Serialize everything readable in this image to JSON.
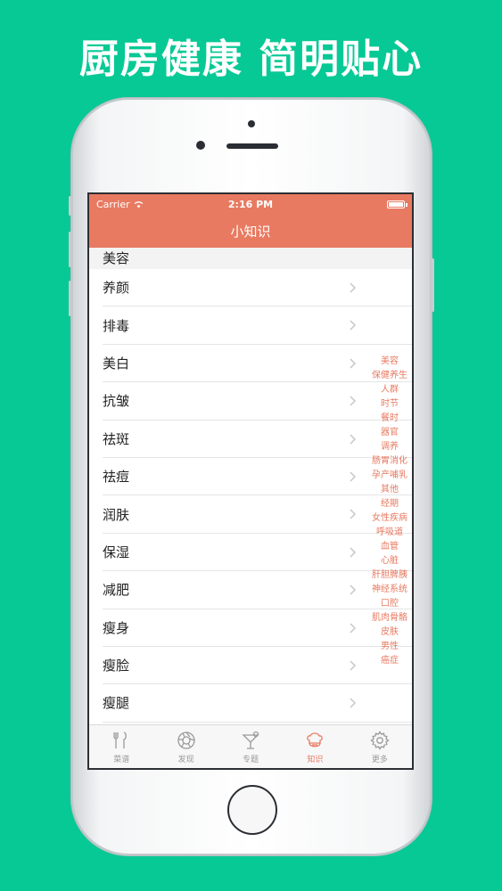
{
  "headline": "厨房健康 简明贴心",
  "status_bar": {
    "carrier": "Carrier",
    "time": "2:16 PM"
  },
  "nav": {
    "title": "小知识"
  },
  "section": {
    "title": "美容"
  },
  "list": {
    "items": [
      {
        "label": "养颜"
      },
      {
        "label": "排毒"
      },
      {
        "label": "美白"
      },
      {
        "label": "抗皱"
      },
      {
        "label": "祛斑"
      },
      {
        "label": "祛痘"
      },
      {
        "label": "润肤"
      },
      {
        "label": "保湿"
      },
      {
        "label": "减肥"
      },
      {
        "label": "瘦身"
      },
      {
        "label": "瘦脸"
      },
      {
        "label": "瘦腿"
      }
    ]
  },
  "index": {
    "items": [
      "美容",
      "保健养生",
      "人群",
      "时节",
      "餐时",
      "器官",
      "调养",
      "肠胃消化",
      "孕产哺乳",
      "其他",
      "经期",
      "女性疾病",
      "呼吸道",
      "血管",
      "心脏",
      "肝胆脾胰",
      "神经系统",
      "口腔",
      "肌肉骨骼",
      "皮肤",
      "男性",
      "癌症"
    ]
  },
  "tabs": {
    "items": [
      {
        "label": "菜谱",
        "icon": "fork-knife-icon",
        "active": false
      },
      {
        "label": "发现",
        "icon": "aperture-icon",
        "active": false
      },
      {
        "label": "专题",
        "icon": "cocktail-icon",
        "active": false
      },
      {
        "label": "知识",
        "icon": "chef-hat-icon",
        "active": true
      },
      {
        "label": "更多",
        "icon": "gear-icon",
        "active": false
      }
    ]
  },
  "colors": {
    "background": "#07c995",
    "accent": "#e87a61",
    "inactive": "#9a9a9a"
  }
}
